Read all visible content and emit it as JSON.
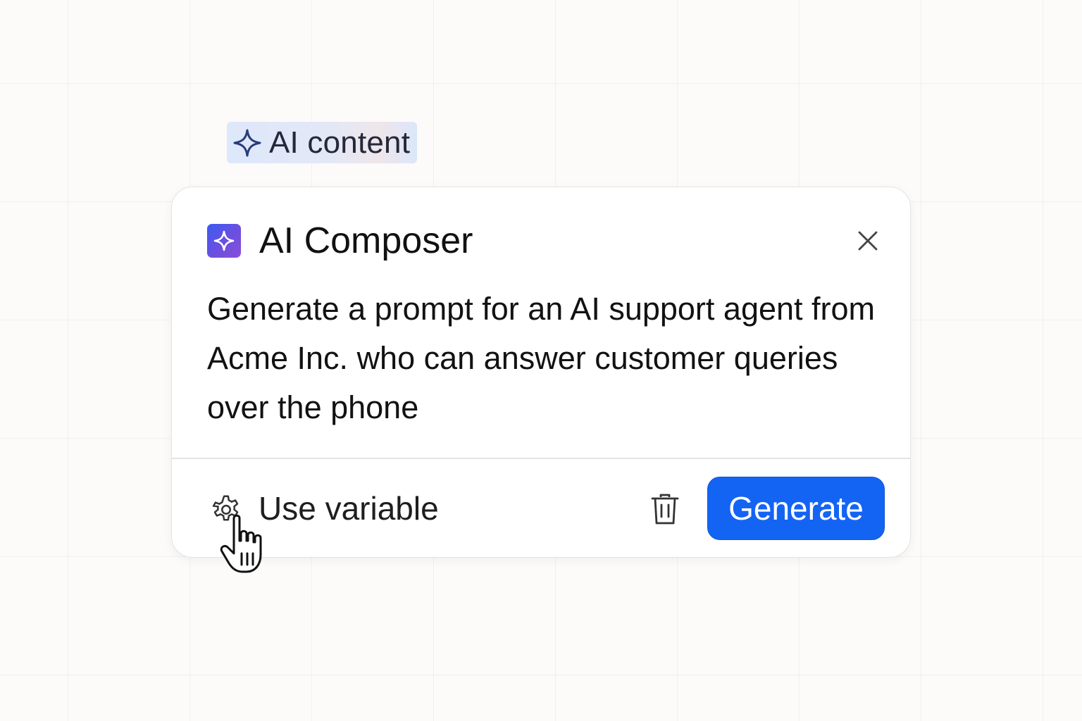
{
  "chip": {
    "icon": "sparkle-outline-icon",
    "label": "AI content"
  },
  "composer": {
    "icon": "sparkle-badge-icon",
    "title": "AI Composer",
    "close_icon": "close-icon",
    "prompt": "Generate a prompt for an AI support agent from Acme Inc. who can answer customer queries over the phone",
    "footer": {
      "variable_icon": "gear-icon",
      "variable_label": "Use variable",
      "delete_icon": "trash-icon",
      "generate_label": "Generate"
    }
  },
  "cursor": {
    "icon": "hand-pointer-cursor-icon"
  },
  "colors": {
    "accent": "#1464f4",
    "badge_gradient_start": "#3b5bf0",
    "badge_gradient_end": "#8a4fd8",
    "chip_background": "#dde8fb",
    "chip_icon": "#2a3b78"
  }
}
